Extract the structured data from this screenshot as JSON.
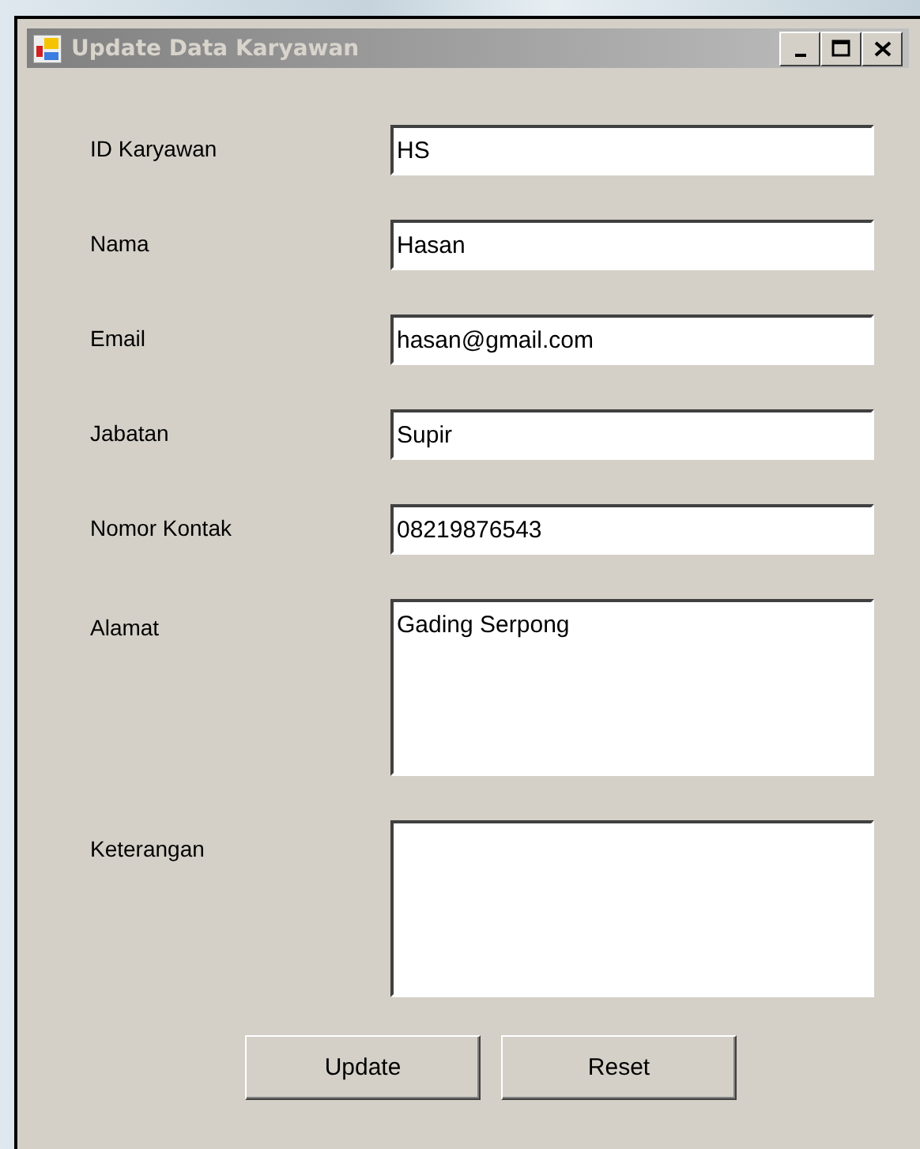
{
  "window": {
    "title": "Update Data Karyawan"
  },
  "fields": [
    {
      "label": "ID Karyawan",
      "value": "HS",
      "kind": "single"
    },
    {
      "label": "Nama",
      "value": "Hasan",
      "kind": "single"
    },
    {
      "label": "Email",
      "value": "hasan@gmail.com",
      "kind": "single"
    },
    {
      "label": "Jabatan",
      "value": "Supir",
      "kind": "single"
    },
    {
      "label": "Nomor Kontak",
      "value": "08219876543",
      "kind": "single"
    },
    {
      "label": "Alamat",
      "value": "Gading Serpong",
      "kind": "multi"
    },
    {
      "label": "Keterangan",
      "kind": "multi"
    }
  ],
  "buttons": [
    "Update",
    "Reset"
  ]
}
